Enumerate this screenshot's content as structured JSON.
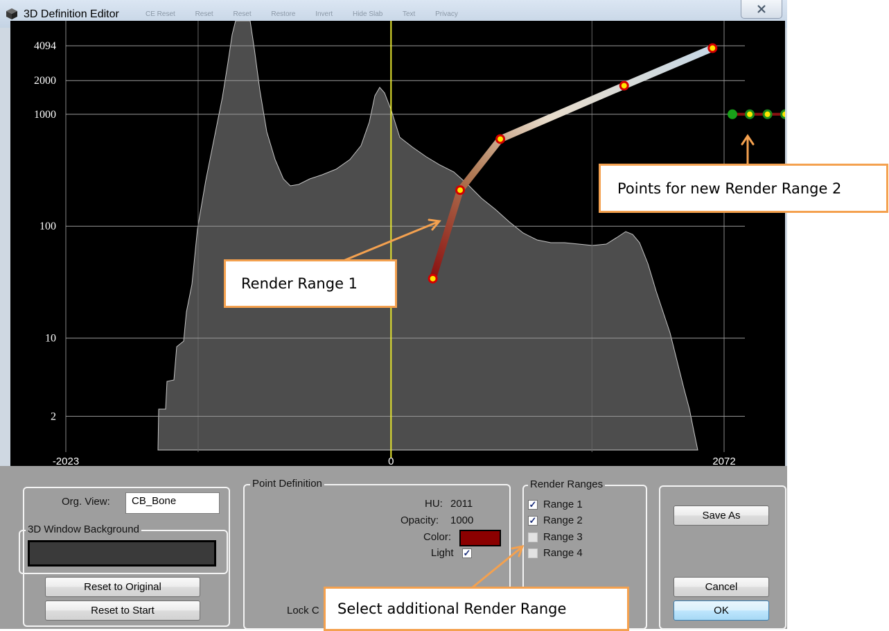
{
  "window": {
    "title": "3D Definition Editor"
  },
  "ghost_toolbar": [
    "CE Reset",
    "Reset",
    "Reset",
    "Restore",
    "Invert",
    "Hide Slab",
    "Text",
    "Privacy"
  ],
  "graph": {
    "y_ticks": [
      "4094",
      "2000",
      "1000",
      "100",
      "10",
      "2"
    ],
    "x_ticks": [
      "-2023",
      "0",
      "2072"
    ]
  },
  "chart_data": {
    "type": "line",
    "title": "",
    "xlabel": "",
    "ylabel": "",
    "x_range": [
      -2023,
      2072
    ],
    "y_scale": "log",
    "y_range": [
      1,
      4094
    ],
    "y_ticks": [
      2,
      10,
      100,
      1000,
      2000,
      4094
    ],
    "x_ticks": [
      -2023,
      0,
      2072
    ],
    "vertical_marker_x": 0,
    "colors": {
      "marker_line": "#e6e630",
      "histogram": "#8c8c8c"
    },
    "series": [
      {
        "name": "Render Range 1",
        "x": [
          260,
          430,
          680,
          1450,
          2000
        ],
        "y": [
          34,
          210,
          600,
          1800,
          3900
        ]
      },
      {
        "name": "Points for new Render Range 2",
        "x": [
          2072,
          2180,
          2290,
          2400
        ],
        "y": [
          1000,
          1000,
          1000,
          1000
        ]
      }
    ]
  },
  "org_view": {
    "label": "Org. View:",
    "value": "CB_Bone"
  },
  "background_group": {
    "legend": "3D Window Background",
    "color": "#3a3a3a"
  },
  "buttons": {
    "reset_original": "Reset to Original",
    "reset_start": "Reset to Start",
    "save_as": "Save As",
    "cancel": "Cancel",
    "ok": "OK"
  },
  "point_definition": {
    "legend": "Point Definition",
    "hu_label": "HU:",
    "hu_value": "2011",
    "opacity_label": "Opacity:",
    "opacity_value": "1000",
    "color_label": "Color:",
    "color_value": "#8b0000",
    "light_label": "Light",
    "lock_label": "Lock C"
  },
  "render_ranges": {
    "legend": "Render Ranges",
    "items": [
      {
        "label": "Range 1",
        "checked": true
      },
      {
        "label": "Range 2",
        "checked": true
      },
      {
        "label": "Range 3",
        "checked": false
      },
      {
        "label": "Range 4",
        "checked": false
      }
    ]
  },
  "callouts": {
    "range2": "Points for new Render Range 2",
    "range1": "Render Range 1",
    "select": "Select additional Render Range"
  },
  "check_mark": "✓"
}
